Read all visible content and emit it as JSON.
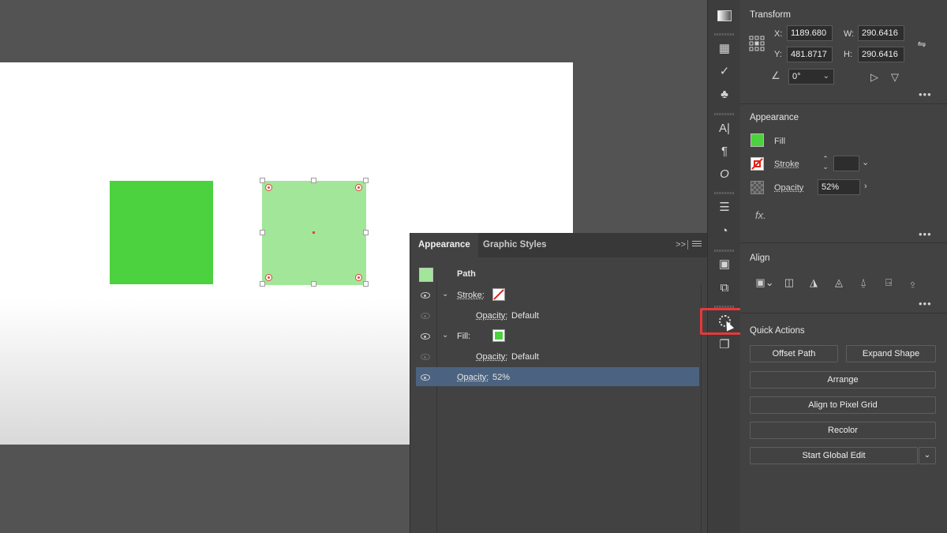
{
  "appearance_panel": {
    "tabs": [
      "Appearance",
      "Graphic Styles"
    ],
    "collapse_label": ">>",
    "path_label": "Path",
    "stroke_label": "Stroke:",
    "stroke_opacity_label": "Opacity:",
    "stroke_opacity_value": "Default",
    "fill_label": "Fill:",
    "fill_opacity_label": "Opacity:",
    "fill_opacity_value": "Default",
    "opacity_label": "Opacity:",
    "opacity_value": "52%"
  },
  "properties": {
    "transform": {
      "title": "Transform",
      "x_label": "X:",
      "x_value": "1189.680",
      "y_label": "Y:",
      "y_value": "481.8717",
      "w_label": "W:",
      "w_value": "290.6416",
      "h_label": "H:",
      "h_value": "290.6416",
      "angle_value": "0°"
    },
    "appearance": {
      "title": "Appearance",
      "fill_label": "Fill",
      "stroke_label": "Stroke",
      "opacity_label": "Opacity",
      "opacity_value": "52%",
      "fx_label": "fx."
    },
    "align": {
      "title": "Align"
    },
    "quick_actions": {
      "title": "Quick Actions",
      "offset_path": "Offset Path",
      "expand_shape": "Expand Shape",
      "arrange": "Arrange",
      "align_pixel": "Align to Pixel Grid",
      "recolor": "Recolor",
      "global_edit": "Start Global Edit"
    },
    "more_label": "•••"
  },
  "colors": {
    "fill_green": "#4cd13f",
    "fill_green_52": "#a2e699",
    "selection_row": "#4b6380",
    "highlight": "#e8383a"
  }
}
